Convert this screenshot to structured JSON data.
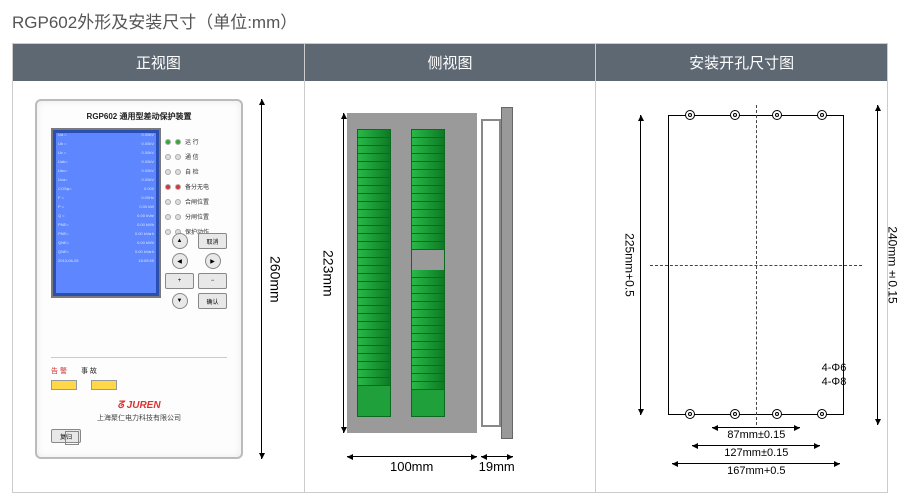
{
  "page_title": "RGP602外形及安装尺寸（单位:mm）",
  "columns": {
    "front": "正视图",
    "side": "侧视图",
    "cutout": "安装开孔尺寸图"
  },
  "device": {
    "title": "RGP602 通用型差动保护装置",
    "screen_rows": [
      [
        "Ua =",
        "0.00kV"
      ],
      [
        "Ub =",
        "0.00kV"
      ],
      [
        "Uc =",
        "0.00kV"
      ],
      [
        "Uab=",
        "0.00kV"
      ],
      [
        "Ubc=",
        "0.00kV"
      ],
      [
        "Uca=",
        "0.00kV"
      ],
      [
        "COSφ=",
        "0.000"
      ],
      [
        "F =",
        "0.00Hz"
      ],
      [
        "P =",
        "0.00 kW"
      ],
      [
        "Q =",
        "0.00 kVar"
      ],
      [
        "PNE=",
        "0.00 kWh"
      ],
      [
        "PNE=",
        "0.00 kVarh"
      ],
      [
        "QNE=",
        "0.00 kWh"
      ],
      [
        "QNE=",
        "0.00 kVarh"
      ],
      [
        "2013-06-25",
        "15:09:55"
      ]
    ],
    "leds": [
      {
        "lbl": "运 行",
        "color": "green"
      },
      {
        "lbl": "通 信",
        "color": ""
      },
      {
        "lbl": "自 检",
        "color": ""
      },
      {
        "lbl": "备分无电",
        "color": "red"
      },
      {
        "lbl": "合闸位置",
        "color": ""
      },
      {
        "lbl": "分闸位置",
        "color": ""
      },
      {
        "lbl": "保护动作",
        "color": ""
      }
    ],
    "keys": {
      "up": "▲",
      "cancel": "取消",
      "left": "◀",
      "right": "▶",
      "plus": "+",
      "minus": "−",
      "down": "▼",
      "confirm": "确认"
    },
    "alarm_labels": [
      "告 警",
      "事 故"
    ],
    "logo_text": "JUREN",
    "logo_sub": "上海聚仁电力科技有限公司",
    "reset": "复归"
  },
  "dims": {
    "front_h": "260mm",
    "side_h": "223mm",
    "side_w1": "100mm",
    "side_w2": "19mm",
    "cut_h1": "225mm+0.5",
    "cut_h2": "240mm±0.15",
    "cut_w1": "87mm±0.15",
    "cut_w2": "127mm±0.15",
    "cut_w3": "167mm+0.5",
    "hole1": "4-Φ6",
    "hole2": "4-Φ8"
  }
}
